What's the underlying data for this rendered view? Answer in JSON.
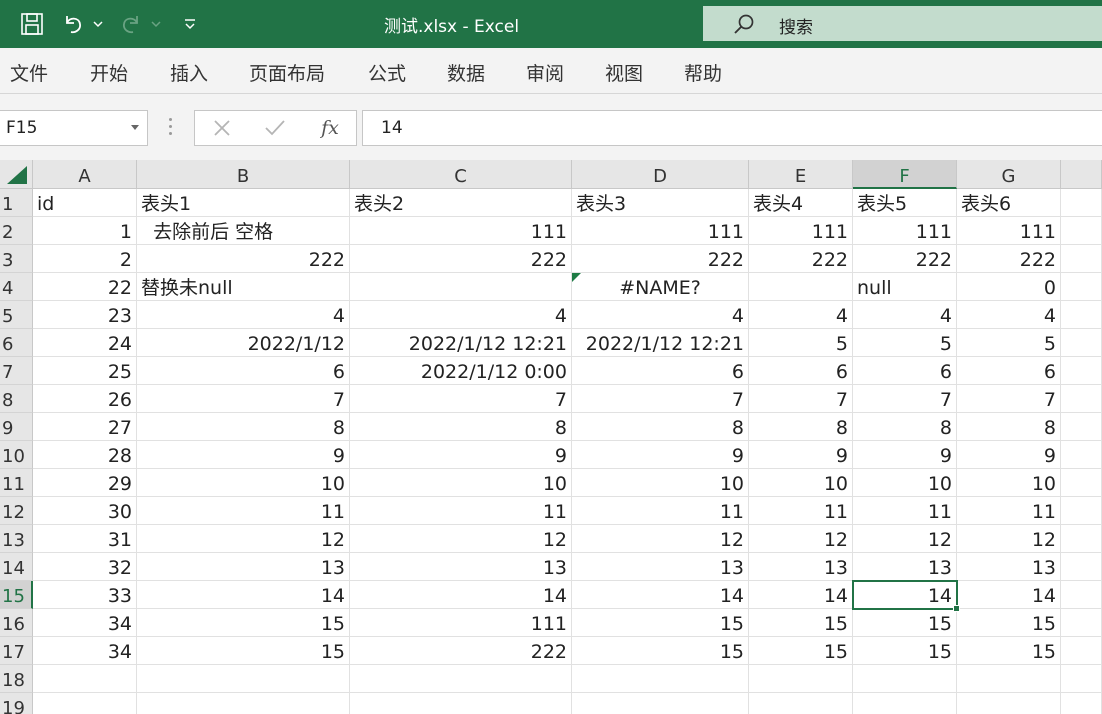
{
  "app": {
    "title": "测试.xlsx  -  Excel",
    "search_label": "搜索"
  },
  "menu": [
    "文件",
    "开始",
    "插入",
    "页面布局",
    "公式",
    "数据",
    "审阅",
    "视图",
    "帮助"
  ],
  "formula_bar": {
    "name_box": "F15",
    "fx_label": "fx",
    "formula": "14"
  },
  "sheet": {
    "columns": [
      "A",
      "B",
      "C",
      "D",
      "E",
      "F",
      "G"
    ],
    "active_cell": "F15",
    "rows": [
      [
        "id",
        "表头1",
        "表头2",
        "表头3",
        "表头4",
        "表头5",
        "表头6"
      ],
      [
        "1",
        "  去除前后 空格",
        "111",
        "111",
        "111",
        "111",
        "111"
      ],
      [
        "2",
        "222",
        "222",
        "222",
        "222",
        "222",
        "222"
      ],
      [
        "22",
        "替换未null",
        "",
        "#NAME?",
        "",
        "null",
        "0"
      ],
      [
        "23",
        "4",
        "4",
        "4",
        "4",
        "4",
        "4"
      ],
      [
        "24",
        "2022/1/12",
        "2022/1/12 12:21",
        "2022/1/12 12:21",
        "5",
        "5",
        "5"
      ],
      [
        "25",
        "6",
        "2022/1/12 0:00",
        "6",
        "6",
        "6",
        "6"
      ],
      [
        "26",
        "7",
        "7",
        "7",
        "7",
        "7",
        "7"
      ],
      [
        "27",
        "8",
        "8",
        "8",
        "8",
        "8",
        "8"
      ],
      [
        "28",
        "9",
        "9",
        "9",
        "9",
        "9",
        "9"
      ],
      [
        "29",
        "10",
        "10",
        "10",
        "10",
        "10",
        "10"
      ],
      [
        "30",
        "11",
        "11",
        "11",
        "11",
        "11",
        "11"
      ],
      [
        "31",
        "12",
        "12",
        "12",
        "12",
        "12",
        "12"
      ],
      [
        "32",
        "13",
        "13",
        "13",
        "13",
        "13",
        "13"
      ],
      [
        "33",
        "14",
        "14",
        "14",
        "14",
        "14",
        "14"
      ],
      [
        "34",
        "15",
        "111",
        "15",
        "15",
        "15",
        "15"
      ],
      [
        "34",
        "15",
        "222",
        "15",
        "15",
        "15",
        "15"
      ],
      [
        "",
        "",
        "",
        "",
        "",
        "",
        ""
      ],
      [
        "",
        "",
        "",
        "",
        "",
        "",
        ""
      ]
    ]
  },
  "colors": {
    "accent": "#217346"
  }
}
